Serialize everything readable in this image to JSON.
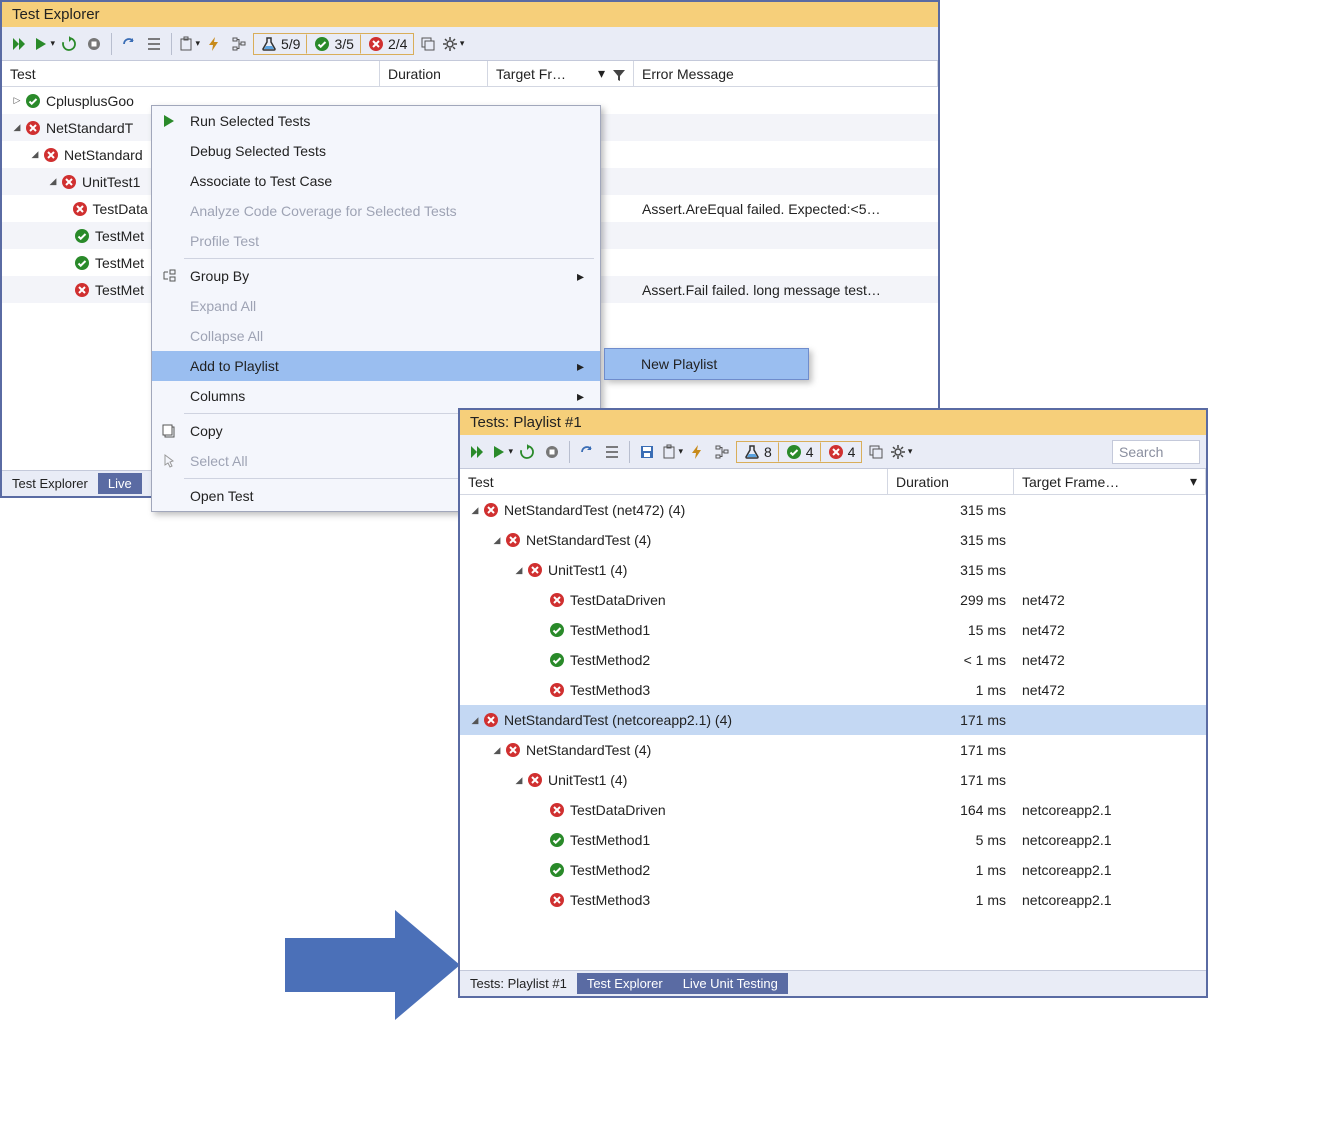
{
  "pane1": {
    "title": "Test Explorer",
    "counts": {
      "flask": "5/9",
      "pass": "3/5",
      "fail": "2/4"
    },
    "columns": {
      "test": "Test",
      "duration": "Duration",
      "target": "Target Fr…",
      "error": "Error Message"
    },
    "tree": [
      {
        "name": "CplusplusGoo",
        "status": "pass",
        "exp": "right",
        "indent": 0
      },
      {
        "name": "NetStandardT",
        "status": "fail",
        "exp": "down",
        "indent": 0
      },
      {
        "name": "NetStandard",
        "status": "fail",
        "exp": "down",
        "indent": 1
      },
      {
        "name": "UnitTest1",
        "status": "fail",
        "exp": "down",
        "indent": 2
      },
      {
        "name": "TestData",
        "status": "fail",
        "indent": 3,
        "error": "Assert.AreEqual failed. Expected:<5…"
      },
      {
        "name": "TestMet",
        "status": "pass",
        "indent": 3
      },
      {
        "name": "TestMet",
        "status": "pass",
        "indent": 3
      },
      {
        "name": "TestMet",
        "status": "fail",
        "indent": 3,
        "error": "Assert.Fail failed. long message test…"
      }
    ],
    "tabs": {
      "a": "Test Explorer",
      "b": "Live"
    }
  },
  "ctx": {
    "items": [
      {
        "label": "Run Selected Tests",
        "icon": "play"
      },
      {
        "label": "Debug Selected Tests"
      },
      {
        "label": "Associate to Test Case"
      },
      {
        "label": "Analyze Code Coverage for Selected Tests",
        "disabled": true
      },
      {
        "label": "Profile Test",
        "disabled": true
      },
      {
        "sep": true
      },
      {
        "label": "Group By",
        "icon": "group",
        "arrow": true
      },
      {
        "label": "Expand All",
        "disabled": true
      },
      {
        "label": "Collapse All",
        "disabled": true
      },
      {
        "label": "Add to Playlist",
        "arrow": true,
        "hover": true
      },
      {
        "label": "Columns",
        "arrow": true
      },
      {
        "sep": true
      },
      {
        "label": "Copy",
        "icon": "copy"
      },
      {
        "label": "Select All",
        "disabled": true,
        "icon": "cursor"
      },
      {
        "sep": true
      },
      {
        "label": "Open Test"
      }
    ],
    "submenu_item": "New Playlist"
  },
  "pane2": {
    "title": "Tests: Playlist #1",
    "counts": {
      "flask": "8",
      "pass": "4",
      "fail": "4"
    },
    "search_placeholder": "Search",
    "columns": {
      "test": "Test",
      "duration": "Duration",
      "target": "Target Frame…"
    },
    "tree": [
      {
        "name": "NetStandardTest (net472)  (4)",
        "status": "fail",
        "exp": "down",
        "indent": 0,
        "dur": "315 ms"
      },
      {
        "name": "NetStandardTest  (4)",
        "status": "fail",
        "exp": "down",
        "indent": 1,
        "dur": "315 ms"
      },
      {
        "name": "UnitTest1  (4)",
        "status": "fail",
        "exp": "down",
        "indent": 2,
        "dur": "315 ms"
      },
      {
        "name": "TestDataDriven",
        "status": "fail",
        "indent": 3,
        "dur": "299 ms",
        "tgt": "net472"
      },
      {
        "name": "TestMethod1",
        "status": "pass",
        "indent": 3,
        "dur": "15 ms",
        "tgt": "net472"
      },
      {
        "name": "TestMethod2",
        "status": "pass",
        "indent": 3,
        "dur": "< 1 ms",
        "tgt": "net472"
      },
      {
        "name": "TestMethod3",
        "status": "fail",
        "indent": 3,
        "dur": "1 ms",
        "tgt": "net472"
      },
      {
        "name": "NetStandardTest (netcoreapp2.1)  (4)",
        "status": "fail",
        "exp": "down",
        "indent": 0,
        "dur": "171 ms",
        "hl": true
      },
      {
        "name": "NetStandardTest  (4)",
        "status": "fail",
        "exp": "down",
        "indent": 1,
        "dur": "171 ms"
      },
      {
        "name": "UnitTest1  (4)",
        "status": "fail",
        "exp": "down",
        "indent": 2,
        "dur": "171 ms"
      },
      {
        "name": "TestDataDriven",
        "status": "fail",
        "indent": 3,
        "dur": "164 ms",
        "tgt": "netcoreapp2.1"
      },
      {
        "name": "TestMethod1",
        "status": "pass",
        "indent": 3,
        "dur": "5 ms",
        "tgt": "netcoreapp2.1"
      },
      {
        "name": "TestMethod2",
        "status": "pass",
        "indent": 3,
        "dur": "1 ms",
        "tgt": "netcoreapp2.1"
      },
      {
        "name": "TestMethod3",
        "status": "fail",
        "indent": 3,
        "dur": "1 ms",
        "tgt": "netcoreapp2.1"
      }
    ],
    "tabs": {
      "a": "Tests: Playlist #1",
      "b": "Test Explorer",
      "c": "Live Unit Testing"
    }
  }
}
